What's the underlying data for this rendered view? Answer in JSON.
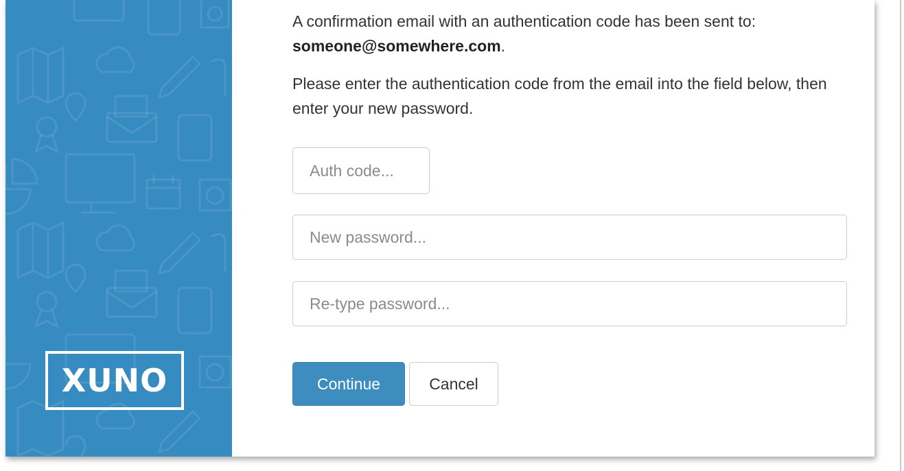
{
  "message": {
    "line1": "A confirmation email with an authentication code has been sent to:",
    "email": "someone@somewhere.com",
    "email_suffix": ".",
    "instructions": "Please enter the authentication code from the email into the field below, then enter your new password."
  },
  "form": {
    "auth_code_placeholder": "Auth code...",
    "new_password_placeholder": "New password...",
    "retype_password_placeholder": "Re-type password..."
  },
  "buttons": {
    "continue_label": "Continue",
    "cancel_label": "Cancel"
  },
  "brand": {
    "logo_text": "XUNO",
    "panel_color": "#368bc1",
    "accent_color": "#3e8dbf"
  },
  "icons": [
    "map-icon",
    "cloud-icon",
    "pencil-icon",
    "envelope-icon",
    "tablet-icon",
    "award-icon",
    "monitor-icon",
    "pie-chart-icon",
    "calendar-icon",
    "camera-icon",
    "location-pin-icon"
  ]
}
